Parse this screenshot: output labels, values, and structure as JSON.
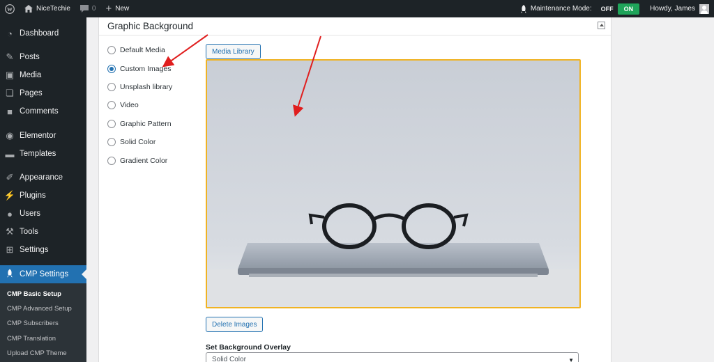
{
  "adminbar": {
    "site_name": "NiceTechie",
    "comments_count": "0",
    "new_label": "New",
    "maintenance_label": "Maintenance Mode:",
    "off_label": "OFF",
    "on_label": "ON",
    "howdy": "Howdy, James"
  },
  "sidebar": {
    "items": [
      {
        "label": "Dashboard",
        "icon": "dashboard-icon"
      },
      {
        "label": "Posts",
        "icon": "pin-icon"
      },
      {
        "label": "Media",
        "icon": "media-icon"
      },
      {
        "label": "Pages",
        "icon": "page-icon"
      },
      {
        "label": "Comments",
        "icon": "comment-icon"
      },
      {
        "label": "Elementor",
        "icon": "elementor-icon"
      },
      {
        "label": "Templates",
        "icon": "folder-icon"
      },
      {
        "label": "Appearance",
        "icon": "brush-icon"
      },
      {
        "label": "Plugins",
        "icon": "plug-icon"
      },
      {
        "label": "Users",
        "icon": "user-icon"
      },
      {
        "label": "Tools",
        "icon": "wrench-icon"
      },
      {
        "label": "Settings",
        "icon": "settings-icon"
      },
      {
        "label": "CMP Settings",
        "icon": "rocket-icon"
      }
    ],
    "submenu": [
      "CMP Basic Setup",
      "CMP Advanced Setup",
      "CMP Subscribers",
      "CMP Translation",
      "Upload CMP Theme"
    ]
  },
  "panel": {
    "title": "Graphic Background",
    "options": [
      "Default Media",
      "Custom Images",
      "Unsplash library",
      "Video",
      "Graphic Pattern",
      "Solid Color",
      "Gradient Color"
    ],
    "selected_option": "Custom Images",
    "media_library_label": "Media Library",
    "delete_images_label": "Delete Images",
    "overlay_label": "Set Background Overlay",
    "overlay_value": "Solid Color"
  },
  "colors": {
    "accent": "#2271b1",
    "highlight_border": "#f0b323",
    "toggle_on": "#1fa45a",
    "annotation_arrow": "#e01e1e"
  }
}
